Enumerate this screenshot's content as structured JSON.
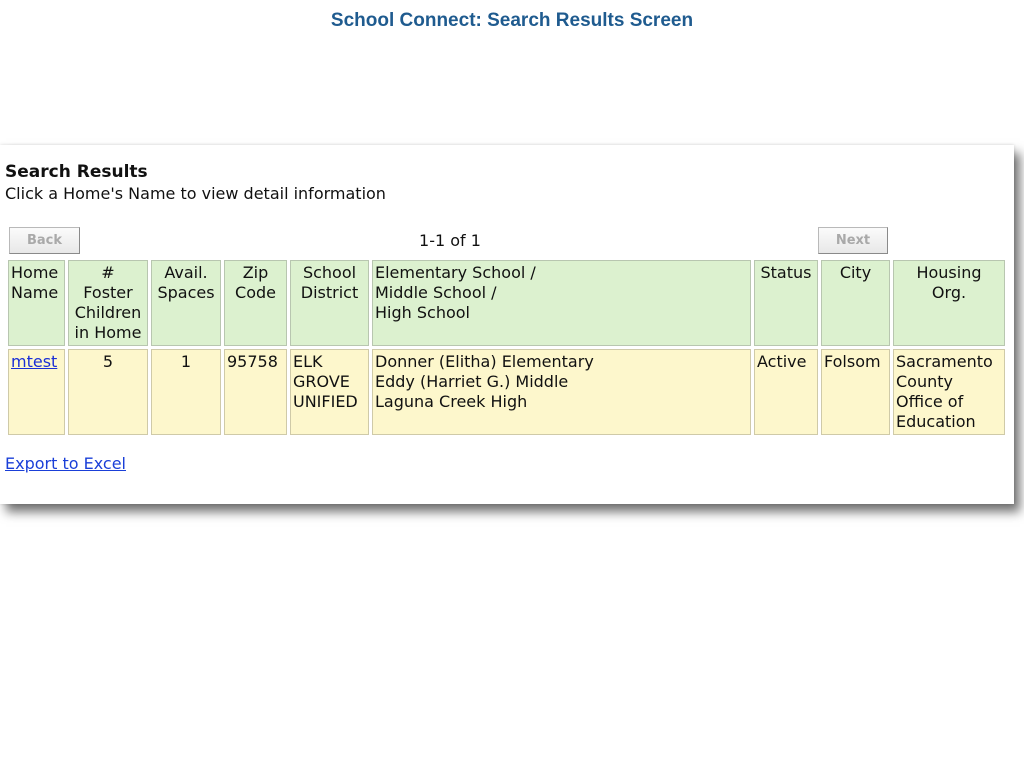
{
  "page": {
    "title": "School Connect: Search Results Screen"
  },
  "results": {
    "heading": "Search Results",
    "subheading": "Click a Home's Name to view detail information",
    "back_label": "Back",
    "next_label": "Next",
    "pager_text": "1-1 of 1",
    "columns": [
      "Home\nName",
      "#\nFoster\nChildren\nin Home",
      "Avail.\nSpaces",
      "Zip\nCode",
      "School\nDistrict",
      "Elementary School /\nMiddle School /\nHigh School",
      "Status",
      "City",
      "Housing\nOrg."
    ],
    "rows": [
      {
        "home_name": "mtest",
        "foster_children": "5",
        "avail_spaces": "1",
        "zip": "95758",
        "district": "ELK\nGROVE\nUNIFIED",
        "schools": "Donner (Elitha) Elementary\nEddy (Harriet G.) Middle\nLaguna Creek High",
        "status": "Active",
        "city": "Folsom",
        "housing_org": "Sacramento\nCounty\nOffice of\nEducation"
      }
    ],
    "export_label": "Export to Excel"
  },
  "colors": {
    "title": "#1f5b8f",
    "header_bg": "#dcf1cf",
    "row_bg": "#fdf7cc",
    "link": "#1a2fd6"
  }
}
